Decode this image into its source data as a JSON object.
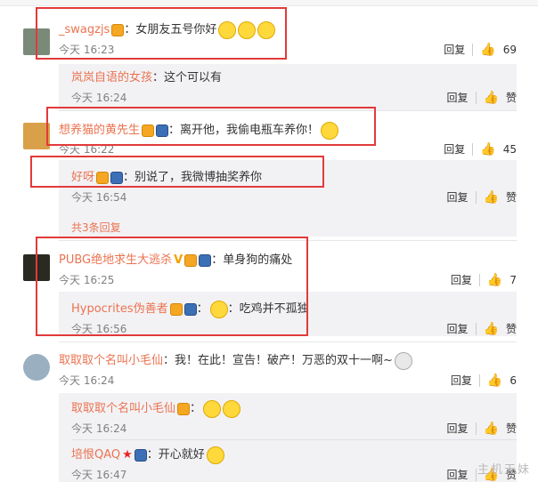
{
  "comments": [
    {
      "name": "_swagzjs",
      "content": "：女朋友五号你好",
      "time": "今天 16:23",
      "reply": "回复",
      "likes": "69",
      "avatar_color": "#7a8a78"
    },
    {
      "name": "想养猫的黄先生",
      "content": "：离开他，我偷电瓶车养你！",
      "time": "今天 16:22",
      "reply": "回复",
      "likes": "45",
      "avatar_color": "#d9a04a"
    },
    {
      "name": "PUBG绝地求生大逃杀",
      "content": "：单身狗的痛处",
      "time": "今天 16:25",
      "reply": "回复",
      "likes": "7",
      "avatar_color": "#2a2a22"
    },
    {
      "name": "取取取个名叫小毛仙",
      "content": "：我！在此！宣告！破产！万恶的双十一啊~",
      "time": "今天 16:24",
      "reply": "回复",
      "likes": "6",
      "avatar_color": "#9ab0c0"
    }
  ],
  "replies": [
    {
      "name": "岚岚自语的女孩",
      "content": "：这个可以有",
      "time": "今天 16:24",
      "reply": "回复",
      "like": "赞"
    },
    {
      "name": "好呀",
      "content": "：别说了，我微博抽奖养你",
      "time": "今天 16:54",
      "reply": "回复",
      "like": "赞"
    },
    {
      "name": "Hypocrites伪善者",
      "content": "：吃鸡并不孤独",
      "time": "今天 16:56",
      "reply": "回复",
      "like": "赞"
    },
    {
      "name": "取取取个名叫小毛仙",
      "content": "：",
      "time": "今天 16:24",
      "reply": "回复",
      "like": "赞"
    },
    {
      "name": "培恨QAQ",
      "content": "：开心就好",
      "time": "今天 16:47",
      "reply": "回复",
      "like": "赞"
    }
  ],
  "more_replies": "共3条回复",
  "watermark": "主机天妹",
  "colors": {
    "name": "#eb7350",
    "highlight": "#e23a3a",
    "reply_bg": "#f2f2f5"
  }
}
